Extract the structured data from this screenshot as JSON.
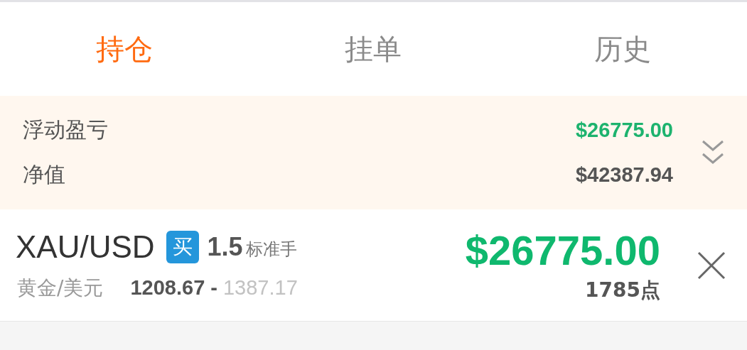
{
  "tabs": [
    {
      "label": "持仓",
      "selected": true
    },
    {
      "label": "挂单",
      "selected": false
    },
    {
      "label": "历史",
      "selected": false
    }
  ],
  "summary": {
    "rows": [
      {
        "label": "浮动盈亏",
        "value": "$26775.00",
        "color": "#1db36e"
      },
      {
        "label": "净值",
        "value": "$42387.94",
        "color": "#555555"
      }
    ]
  },
  "positions": [
    {
      "symbol": "XAU/USD",
      "side": "买",
      "lots": "1.5",
      "lot_unit": "标准手",
      "name": "黄金/美元",
      "open_price": "1208.67",
      "price_separator": "-",
      "current_price": "1387.17",
      "profit": "$26775.00",
      "points": "1785点"
    }
  ]
}
